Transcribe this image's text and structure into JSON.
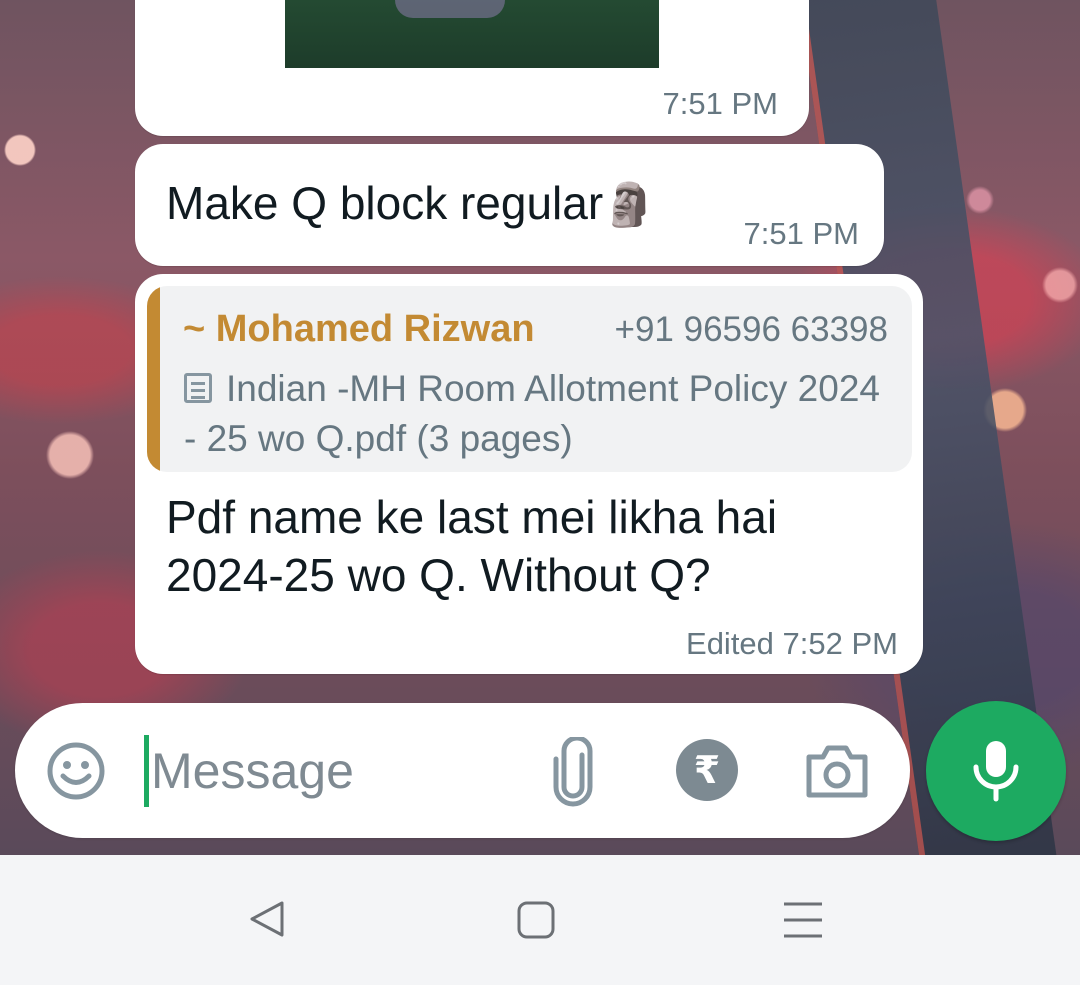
{
  "messages": [
    {
      "type": "image",
      "time": "7:51 PM"
    },
    {
      "type": "text",
      "text": "Make Q block regular",
      "emoji": "🗿",
      "time": "7:51 PM"
    },
    {
      "type": "reply",
      "quote": {
        "author": "~ Mohamed Rizwan",
        "phone": "+91 96596 63398",
        "document": "Indian -MH Room Allotment Policy 2024 - 25 wo Q.pdf (3 pages)"
      },
      "text": "Pdf name ke last mei likha hai 2024-25 wo Q. Without Q?",
      "edited_label": "Edited",
      "time": "7:52 PM"
    }
  ],
  "composer": {
    "placeholder": "Message",
    "icons": [
      "emoji-icon",
      "attach-icon",
      "rupee-icon",
      "camera-icon",
      "mic-icon"
    ]
  },
  "navbar": {
    "icons": [
      "back-icon",
      "home-icon",
      "recent-apps-icon"
    ]
  },
  "colors": {
    "accent_green": "#1daa61",
    "quote_author": "#c38a33",
    "timestamp": "#667781",
    "bubble": "#ffffff"
  }
}
